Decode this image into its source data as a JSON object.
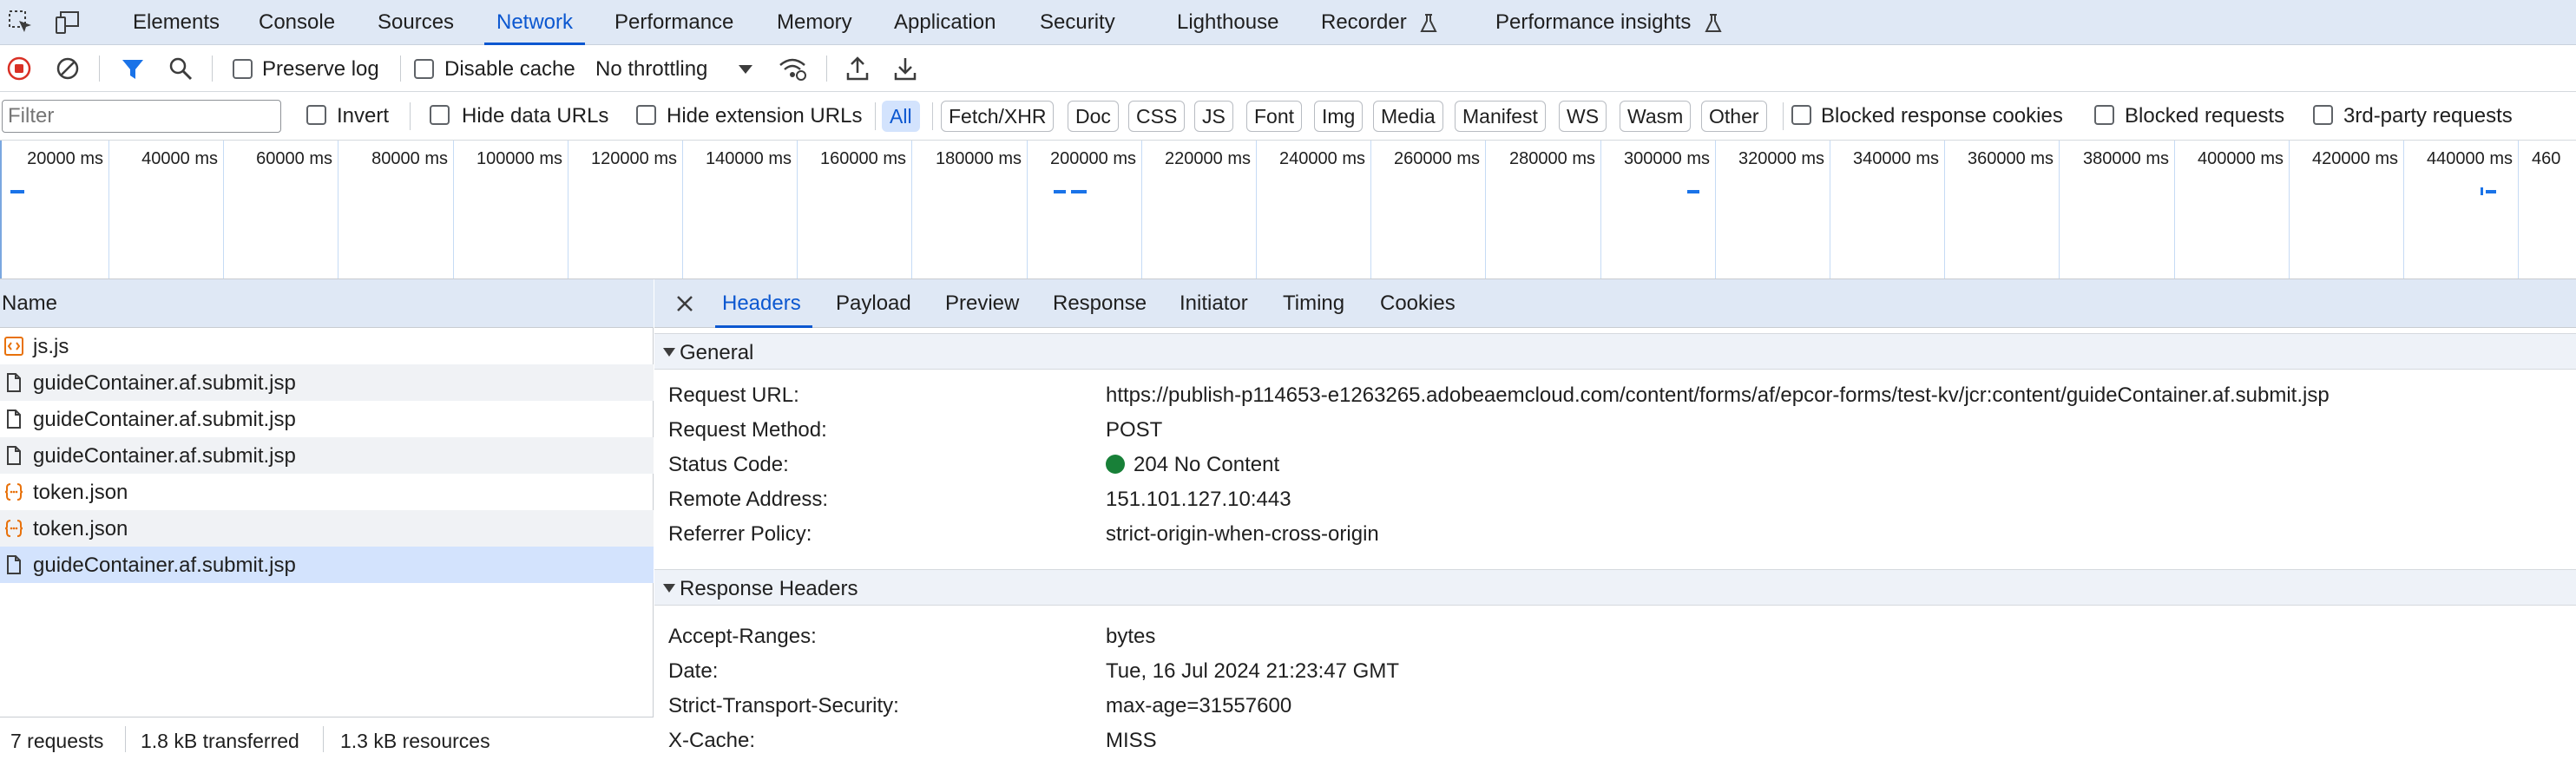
{
  "tabs": [
    {
      "label": "Elements"
    },
    {
      "label": "Console"
    },
    {
      "label": "Sources"
    },
    {
      "label": "Network"
    },
    {
      "label": "Performance"
    },
    {
      "label": "Memory"
    },
    {
      "label": "Application"
    },
    {
      "label": "Security"
    },
    {
      "label": "Lighthouse"
    },
    {
      "label": "Recorder"
    },
    {
      "label": "Performance insights"
    }
  ],
  "active_tab": "Network",
  "toolbar": {
    "preserve_log": "Preserve log",
    "disable_cache": "Disable cache",
    "throttling": "No throttling"
  },
  "filter": {
    "placeholder": "Filter",
    "invert": "Invert",
    "hide_data_urls": "Hide data URLs",
    "hide_extension_urls": "Hide extension URLs",
    "types": [
      "All",
      "Fetch/XHR",
      "Doc",
      "CSS",
      "JS",
      "Font",
      "Img",
      "Media",
      "Manifest",
      "WS",
      "Wasm",
      "Other"
    ],
    "active_type": "All",
    "blocked_response_cookies": "Blocked response cookies",
    "blocked_requests": "Blocked requests",
    "third_party": "3rd-party requests"
  },
  "timeline": {
    "ticks": [
      "20000 ms",
      "40000 ms",
      "60000 ms",
      "80000 ms",
      "100000 ms",
      "120000 ms",
      "140000 ms",
      "160000 ms",
      "180000 ms",
      "200000 ms",
      "220000 ms",
      "240000 ms",
      "260000 ms",
      "280000 ms",
      "300000 ms",
      "320000 ms",
      "340000 ms",
      "360000 ms",
      "380000 ms",
      "400000 ms",
      "420000 ms",
      "440000 ms",
      "460"
    ]
  },
  "requests": {
    "column_name": "Name",
    "items": [
      {
        "name": "js.js",
        "icon": "script-icon"
      },
      {
        "name": "guideContainer.af.submit.jsp",
        "icon": "document-icon"
      },
      {
        "name": "guideContainer.af.submit.jsp",
        "icon": "document-icon"
      },
      {
        "name": "guideContainer.af.submit.jsp",
        "icon": "document-icon"
      },
      {
        "name": "token.json",
        "icon": "json-icon"
      },
      {
        "name": "token.json",
        "icon": "json-icon"
      },
      {
        "name": "guideContainer.af.submit.jsp",
        "icon": "document-icon"
      }
    ],
    "selected_index": 6
  },
  "status": {
    "requests": "7 requests",
    "transferred": "1.8 kB transferred",
    "resources": "1.3 kB resources"
  },
  "detail": {
    "tabs": [
      "Headers",
      "Payload",
      "Preview",
      "Response",
      "Initiator",
      "Timing",
      "Cookies"
    ],
    "active": "Headers",
    "general": {
      "title": "General",
      "rows": [
        {
          "key": "Request URL:",
          "value": "https://publish-p114653-e1263265.adobeaemcloud.com/content/forms/af/epcor-forms/test-kv/jcr:content/guideContainer.af.submit.jsp"
        },
        {
          "key": "Request Method:",
          "value": "POST"
        },
        {
          "key": "Status Code:",
          "value": "204 No Content"
        },
        {
          "key": "Remote Address:",
          "value": "151.101.127.10:443"
        },
        {
          "key": "Referrer Policy:",
          "value": "strict-origin-when-cross-origin"
        }
      ]
    },
    "response_headers": {
      "title": "Response Headers",
      "rows": [
        {
          "key": "Accept-Ranges:",
          "value": "bytes"
        },
        {
          "key": "Date:",
          "value": "Tue, 16 Jul 2024 21:23:47 GMT"
        },
        {
          "key": "Strict-Transport-Security:",
          "value": "max-age=31557600"
        },
        {
          "key": "X-Cache:",
          "value": "MISS"
        }
      ]
    }
  },
  "colors": {
    "accent": "#0b57d0",
    "status_ok": "#188038",
    "record_red": "#d93025"
  }
}
